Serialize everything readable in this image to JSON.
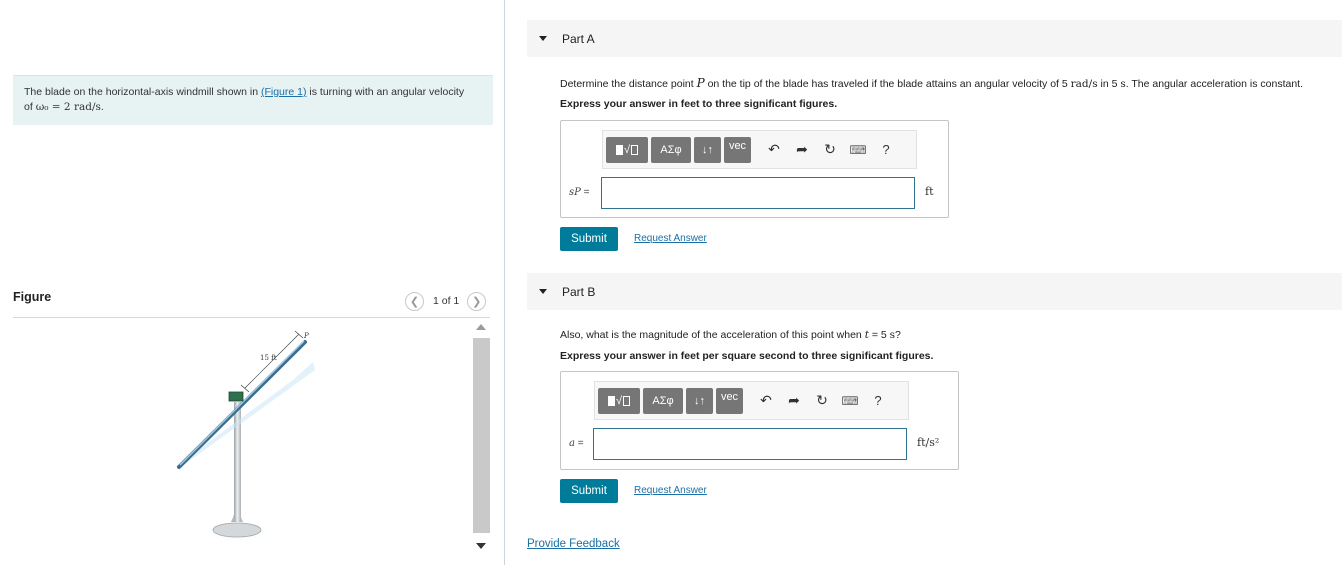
{
  "problem": {
    "text_before": "The blade on the horizontal-axis windmill shown in ",
    "figure_link": "(Figure 1)",
    "text_after": " is turning with an angular velocity",
    "line2_prefix": "of ",
    "omega_expr": "ω₀ = 2 rad/s",
    "line2_suffix": "."
  },
  "figure": {
    "title": "Figure",
    "count": "1 of 1",
    "dim_label": "15 ft",
    "point_label": "P"
  },
  "partA": {
    "title": "Part A",
    "prompt_1": "Determine the distance point ",
    "prompt_var": "P",
    "prompt_2": " on the tip of the blade has traveled if the blade attains an angular velocity of 5 ",
    "prompt_unit1": "rad/s",
    "prompt_3": " in 5 ",
    "prompt_unit2": "s",
    "prompt_4": ". The angular acceleration is constant.",
    "instruction": "Express your answer in feet to three significant figures.",
    "var": "sP",
    "eq": " =",
    "unit": "ft",
    "submit": "Submit",
    "request": "Request Answer"
  },
  "partB": {
    "title": "Part B",
    "prompt_1": "Also, what is the magnitude of the acceleration of this point when ",
    "prompt_var": "t",
    "prompt_2": " = 5 ",
    "prompt_unit": "s",
    "prompt_3": "?",
    "instruction": "Express your answer in feet per square second to three significant figures.",
    "var": "a",
    "eq": " =",
    "unit": "ft/s²",
    "submit": "Submit",
    "request": "Request Answer"
  },
  "toolbar": {
    "greek": "ΑΣφ",
    "arrows": "↓↑",
    "vec": "vec",
    "help": "?"
  },
  "feedback": "Provide Feedback"
}
